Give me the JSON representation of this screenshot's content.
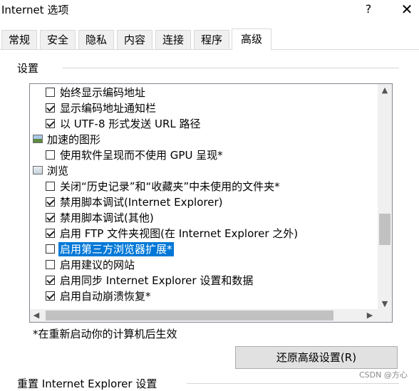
{
  "window": {
    "title": "Internet 选项",
    "help_label": "?",
    "close_label": "✕"
  },
  "tabs": [
    {
      "label": "常规"
    },
    {
      "label": "安全"
    },
    {
      "label": "隐私"
    },
    {
      "label": "内容"
    },
    {
      "label": "连接"
    },
    {
      "label": "程序"
    },
    {
      "label": "高级",
      "active": true
    }
  ],
  "settings": {
    "group_label": "设置",
    "items": [
      {
        "kind": "checkbox",
        "checked": false,
        "label": "始终显示编码地址"
      },
      {
        "kind": "checkbox",
        "checked": true,
        "label": "显示编码地址通知栏"
      },
      {
        "kind": "checkbox",
        "checked": true,
        "label": "以 UTF-8 形式发送 URL 路径"
      },
      {
        "kind": "category",
        "icon": "image-category-icon",
        "label": "加速的图形"
      },
      {
        "kind": "checkbox",
        "checked": false,
        "label": "使用软件呈现而不使用 GPU 呈现*"
      },
      {
        "kind": "category",
        "icon": "browse-category-icon",
        "label": "浏览"
      },
      {
        "kind": "checkbox",
        "checked": false,
        "label": "关闭“历史记录”和“收藏夹”中未使用的文件夹*"
      },
      {
        "kind": "checkbox",
        "checked": true,
        "label": "禁用脚本调试(Internet Explorer)"
      },
      {
        "kind": "checkbox",
        "checked": true,
        "label": "禁用脚本调试(其他)"
      },
      {
        "kind": "checkbox",
        "checked": true,
        "label": "启用 FTP 文件夹视图(在 Internet Explorer 之外)"
      },
      {
        "kind": "checkbox",
        "checked": false,
        "label": "启用第三方浏览器扩展*",
        "selected": true
      },
      {
        "kind": "checkbox",
        "checked": false,
        "label": "启用建议的网站"
      },
      {
        "kind": "checkbox",
        "checked": true,
        "label": "启用同步 Internet Explorer 设置和数据"
      },
      {
        "kind": "checkbox",
        "checked": true,
        "label": "启用自动崩溃恢复*"
      }
    ]
  },
  "note": "*在重新启动你的计算机后生效",
  "restore_button": "还原高级设置(R)",
  "reset_group_label": "重置 Internet Explorer 设置",
  "watermark": "CSDN @方心"
}
